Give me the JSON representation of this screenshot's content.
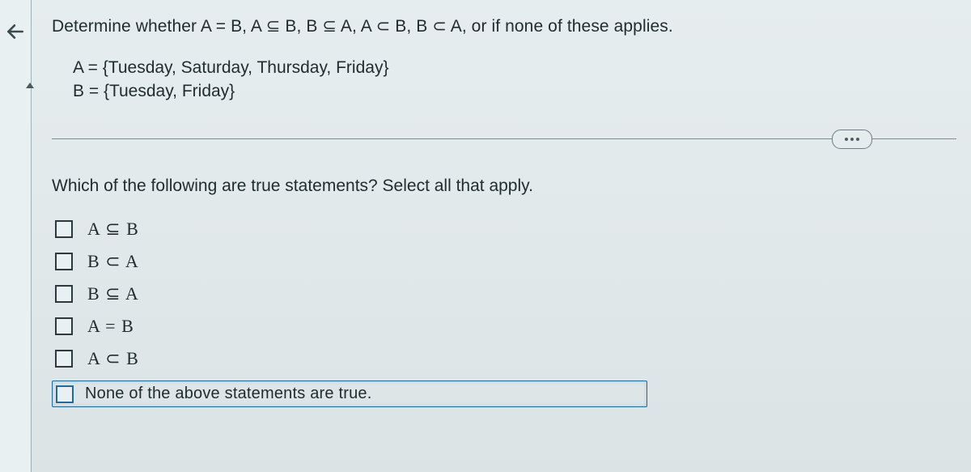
{
  "question": {
    "prompt": "Determine whether A = B, A ⊆ B, B ⊆ A, A ⊂ B, B ⊂ A, or if none of these applies.",
    "setA": "A = {Tuesday, Saturday, Thursday, Friday}",
    "setB": "B = {Tuesday, Friday}",
    "sub_prompt": "Which of the following are true statements? Select all that apply."
  },
  "options": [
    {
      "label": "A ⊆ B"
    },
    {
      "label": "B ⊂ A"
    },
    {
      "label": "B ⊆ A"
    },
    {
      "label": "A = B"
    },
    {
      "label": "A ⊂ B"
    },
    {
      "label": "None of the above statements are true."
    }
  ]
}
